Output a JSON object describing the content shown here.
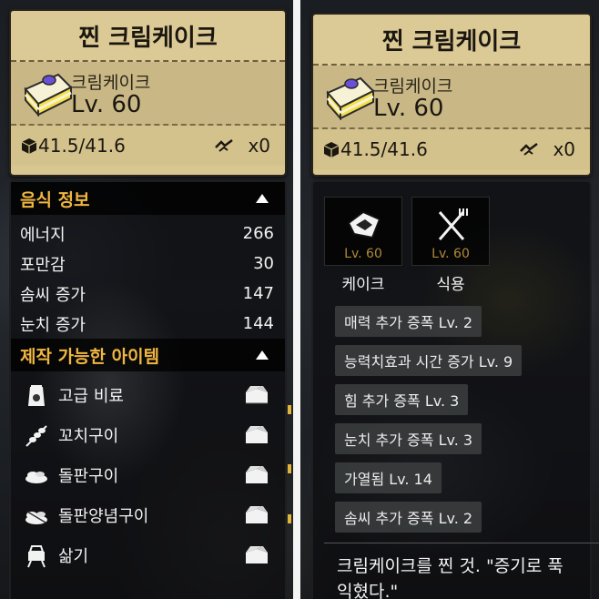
{
  "left": {
    "title": "찐 크림케이크",
    "item_name": "크림케이크",
    "item_level": "Lv. 60",
    "weight": "41.5/41.6",
    "durability": "x0",
    "food_section": {
      "title": "음식 정보",
      "stats": [
        {
          "label": "에너지",
          "value": "266"
        },
        {
          "label": "포만감",
          "value": "30"
        },
        {
          "label": "솜씨 증가",
          "value": "147"
        },
        {
          "label": "눈치 증가",
          "value": "144"
        }
      ]
    },
    "craft_section": {
      "title": "제작 가능한 아이템",
      "items": [
        {
          "label": "고급 비료",
          "icon": "fertilizer-bag-icon"
        },
        {
          "label": "꼬치구이",
          "icon": "skewer-icon"
        },
        {
          "label": "돌판구이",
          "icon": "grilled-food-icon"
        },
        {
          "label": "돌판양념구이",
          "icon": "seasoned-grill-icon"
        },
        {
          "label": "삶기",
          "icon": "pot-icon"
        }
      ]
    }
  },
  "right": {
    "title": "찐 크림케이크",
    "item_name": "크림케이크",
    "item_level": "Lv. 60",
    "weight": "41.5/41.6",
    "durability": "x0",
    "uses": [
      {
        "label": "케이크",
        "level": "Lv. 60",
        "icon": "cake-piece-icon"
      },
      {
        "label": "식용",
        "level": "Lv. 60",
        "icon": "fork-knife-icon"
      }
    ],
    "buffs": [
      "매력 추가 증폭 Lv. 2",
      "능력치효과 시간 증가  Lv. 9",
      "힘 추가 증폭 Lv. 3",
      "눈치 추가 증폭 Lv. 3",
      "가열됨 Lv. 14",
      "솜씨 추가 증폭 Lv. 2"
    ],
    "description": "크림케이크를 찐 것. \"증기로 푹 익혔다.\""
  },
  "colors": {
    "card_bg": "#d9c792",
    "section_title": "#f0b640",
    "level_text": "#b08a34",
    "cake_sponge": "#f4e04a",
    "cake_top": "#6a4fd8"
  }
}
